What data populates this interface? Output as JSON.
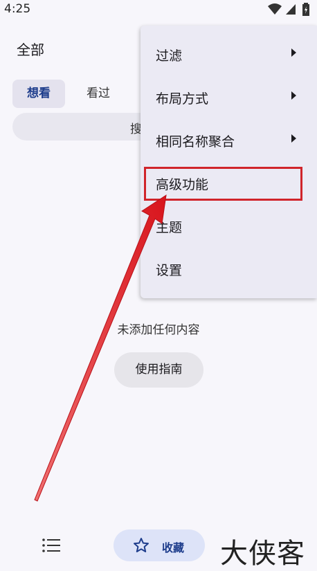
{
  "status_bar": {
    "time": "4:25",
    "icons": [
      "wifi-icon",
      "signal-icon",
      "battery-icon"
    ]
  },
  "header": {
    "title": "全部"
  },
  "tabs": [
    {
      "label": "想看",
      "active": true
    },
    {
      "label": "看过",
      "active": false
    }
  ],
  "search": {
    "text": "搜"
  },
  "menu": {
    "items": [
      {
        "label": "过滤",
        "has_submenu": true
      },
      {
        "label": "布局方式",
        "has_submenu": true
      },
      {
        "label": "相同名称聚合",
        "has_submenu": true
      },
      {
        "label": "高级功能",
        "has_submenu": false,
        "highlighted": true
      },
      {
        "label": "主题",
        "has_submenu": false
      },
      {
        "label": "设置",
        "has_submenu": false
      }
    ]
  },
  "empty_state": {
    "text": "未添加任何内容",
    "button_label": "使用指南"
  },
  "bottom_nav": {
    "list_icon": "list-icon",
    "favorite_icon": "star-icon",
    "favorite_label": "收藏"
  },
  "watermark": {
    "text": "大侠客"
  },
  "colors": {
    "accent": "#1e3d8c",
    "highlight_border": "#d0242a",
    "annotation_arrow": "#e01c24"
  }
}
